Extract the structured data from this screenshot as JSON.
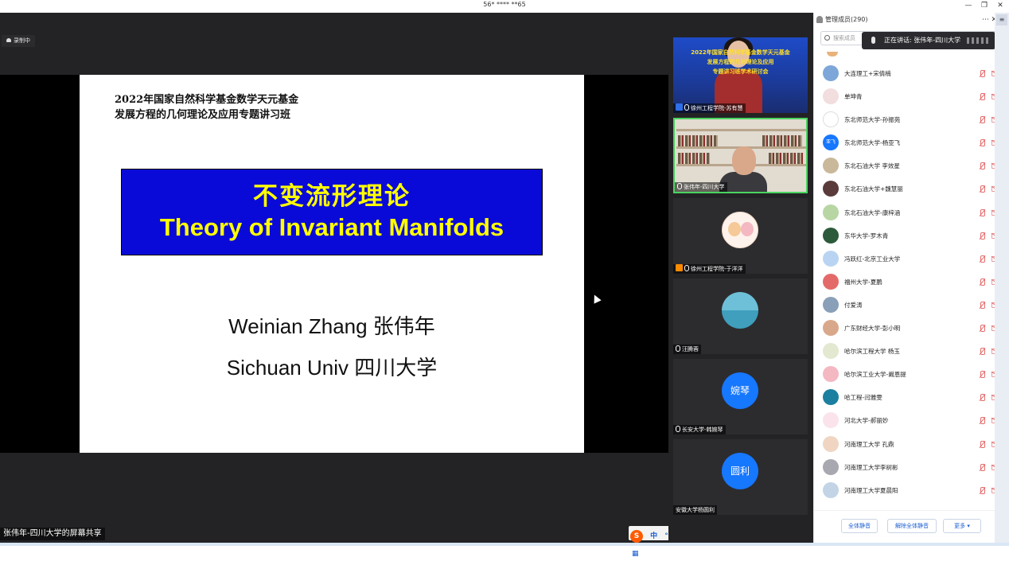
{
  "window": {
    "title": "56* **** **65",
    "minimize_glyph": "—",
    "restore_glyph": "❐",
    "close_glyph": "✕"
  },
  "stage": {
    "recording_label": "录制中",
    "share_label": "张伟年-四川大学的屏幕共享",
    "cursor_icon": "mouse-pointer-icon"
  },
  "slide": {
    "header_line1": "2022年国家自然科学基金数学天元基金",
    "header_line2": "发展方程的几何理论及应用专题讲习班",
    "title_cn": "不变流形理论",
    "title_en": "Theory of Invariant Manifolds",
    "author": "Weinian Zhang 张伟年",
    "affiliation": "Sichuan Univ 四川大学",
    "banner_color": "#0a0ad8",
    "title_color": "#ffff00"
  },
  "ime": {
    "logo": "S",
    "mode": "中",
    "punct": "°,",
    "voice_icon": "microphone-icon",
    "keyboard_icon": "keyboard-icon",
    "skin_icon": "shirt-icon",
    "tools_icon": "grid-icon"
  },
  "gallery": {
    "tiles": [
      {
        "label": "徐州工程学院-苏有慧",
        "banner_line1": "2022年国家自然科学基金数学天元基金",
        "banner_line2": "发展方程的几何理论及应用",
        "banner_line3": "专题讲习班学术研讨会"
      },
      {
        "label": "张伟年-四川大学"
      },
      {
        "label": "徐州工程学院-于洋洋"
      },
      {
        "label": "汪腾蓉"
      },
      {
        "label": "长安大学-韩婉琴",
        "avatar_text": "婉琴"
      },
      {
        "label": "安徽大学杨圆利",
        "avatar_text": "圆利"
      }
    ]
  },
  "panel": {
    "title": "管理成员(290)",
    "more": "⋯",
    "close": "✕",
    "menu": "≡",
    "search_placeholder": "搜索成员",
    "speaking_label": "正在讲话: 张伟年-四川大学",
    "participants": [
      {
        "name": "大连理工+宋倩楠",
        "avatar_color": "#7da7d9",
        "avatar_text": ""
      },
      {
        "name": "单坤青",
        "avatar_color": "#f2dede",
        "avatar_text": ""
      },
      {
        "name": "东北师范大学-孙振苑",
        "avatar_color": "#ffffff",
        "avatar_text": ""
      },
      {
        "name": "东北师范大学-杨亚飞",
        "avatar_color": "#1677ff",
        "avatar_text": "亚飞"
      },
      {
        "name": "东北石油大学 李效星",
        "avatar_color": "#c9b89a",
        "avatar_text": ""
      },
      {
        "name": "东北石油大学+魏慧丽",
        "avatar_color": "#5a3a3a",
        "avatar_text": ""
      },
      {
        "name": "东北石油大学-康梓涵",
        "avatar_color": "#b7d6a3",
        "avatar_text": ""
      },
      {
        "name": "东华大学-罗木青",
        "avatar_color": "#2d5a3a",
        "avatar_text": ""
      },
      {
        "name": "冯跃红-北京工业大学",
        "avatar_color": "#b9d4f2",
        "avatar_text": ""
      },
      {
        "name": "福州大学-夏鹏",
        "avatar_color": "#e46a6a",
        "avatar_text": ""
      },
      {
        "name": "付爱涛",
        "avatar_color": "#8aa0b8",
        "avatar_text": ""
      },
      {
        "name": "广东财经大学-彭小明",
        "avatar_color": "#d9a88a",
        "avatar_text": ""
      },
      {
        "name": "哈尔滨工程大学 杨玉",
        "avatar_color": "#e3e8d0",
        "avatar_text": ""
      },
      {
        "name": "哈尔滨工业大学-阚恩提",
        "avatar_color": "#f4b8c3",
        "avatar_text": ""
      },
      {
        "name": "哈工程-闫雅雯",
        "avatar_color": "#1b7fa0",
        "avatar_text": ""
      },
      {
        "name": "河北大学-郝丽妙",
        "avatar_color": "#fbe3ec",
        "avatar_text": ""
      },
      {
        "name": "河南理工大学 孔鼎",
        "avatar_color": "#f0d6c2",
        "avatar_text": ""
      },
      {
        "name": "河南理工大学李树彬",
        "avatar_color": "#a8a8b0",
        "avatar_text": ""
      },
      {
        "name": "河南理工大学夏晨阳",
        "avatar_color": "#c2d4e6",
        "avatar_text": ""
      }
    ],
    "mute_all_label": "全体静音",
    "unmute_all_label": "解除全体静音",
    "more_label": "更多 ▾"
  }
}
